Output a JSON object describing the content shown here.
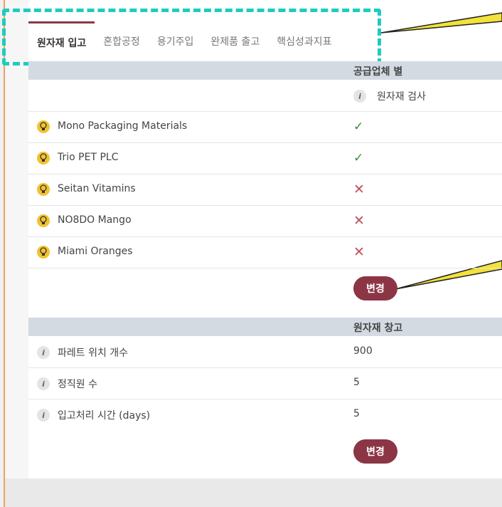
{
  "tabs": [
    {
      "label": "원자재 입고",
      "active": true
    },
    {
      "label": "혼합공정",
      "active": false
    },
    {
      "label": "용기주입",
      "active": false
    },
    {
      "label": "완제품 출고",
      "active": false
    },
    {
      "label": "핵심성과지표",
      "active": false
    }
  ],
  "supplier_section": {
    "header": "공급업체 별",
    "column_label": "원자재 검사",
    "rows": [
      {
        "name": "Mono Packaging Materials",
        "status": "check"
      },
      {
        "name": "Trio PET PLC",
        "status": "check"
      },
      {
        "name": "Seitan Vitamins",
        "status": "cross"
      },
      {
        "name": "NO8DO Mango",
        "status": "cross"
      },
      {
        "name": "Miami Oranges",
        "status": "cross"
      }
    ],
    "change_button": "변경"
  },
  "warehouse_section": {
    "header": "원자재 창고",
    "rows": [
      {
        "label": "파레트 위치 개수",
        "value": "900"
      },
      {
        "label": "정직원 수",
        "value": "5"
      },
      {
        "label": "입고처리 시간 (days)",
        "value": "5"
      }
    ],
    "change_button": "변경"
  },
  "colors": {
    "accent": "#8c3645",
    "highlight": "#1ccdbf",
    "callout": "#f2e23a"
  }
}
